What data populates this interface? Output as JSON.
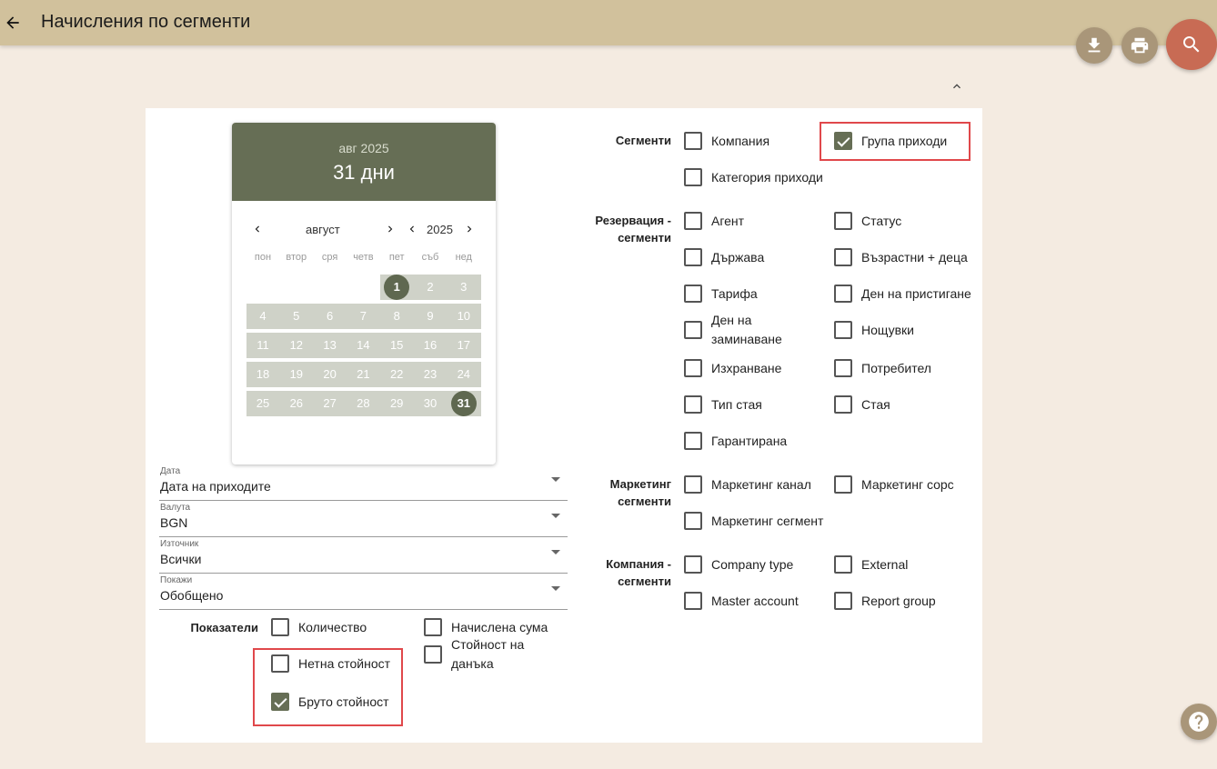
{
  "header": {
    "title": "Начисления по сегменти",
    "back_icon": "arrow-left-icon"
  },
  "actions": {
    "download_icon": "download-icon",
    "print_icon": "print-icon",
    "search_icon": "search-icon",
    "help_icon": "help-icon",
    "collapse_icon": "chevron-up-icon"
  },
  "colors": {
    "topbar": "#d1c19c",
    "accent": "#666e55",
    "search_fab": "#c86b54",
    "highlight": "#e0484b"
  },
  "calendar": {
    "header_month": "авг 2025",
    "header_days": "31 дни",
    "month_label": "август",
    "year_label": "2025",
    "weekdays": [
      "пон",
      "втор",
      "сря",
      "четв",
      "пет",
      "съб",
      "нед"
    ],
    "days": [
      "1",
      "2",
      "3",
      "4",
      "5",
      "6",
      "7",
      "8",
      "9",
      "10",
      "11",
      "12",
      "13",
      "14",
      "15",
      "16",
      "17",
      "18",
      "19",
      "20",
      "21",
      "22",
      "23",
      "24",
      "25",
      "26",
      "27",
      "28",
      "29",
      "30",
      "31"
    ],
    "range_start": "1",
    "range_end": "31"
  },
  "filters": [
    {
      "label": "Дата",
      "value": "Дата на приходите"
    },
    {
      "label": "Валута",
      "value": "BGN"
    },
    {
      "label": "Източник",
      "value": "Всички"
    },
    {
      "label": "Покажи",
      "value": "Обобщено"
    }
  ],
  "indicators": {
    "label": "Показатели",
    "items": [
      {
        "label": "Количество",
        "checked": false
      },
      {
        "label": "Начислена сума",
        "checked": false
      },
      {
        "label": "Нетна стойност",
        "checked": false
      },
      {
        "label": "Стойност на данъка",
        "checked": false
      },
      {
        "label": "Бруто стойност",
        "checked": true
      }
    ]
  },
  "segments": {
    "label": "Сегменти",
    "items": [
      {
        "label": "Компания",
        "checked": false
      },
      {
        "label": "Група приходи",
        "checked": true
      },
      {
        "label": "Категория приходи",
        "checked": false
      }
    ]
  },
  "reservation_segments": {
    "label": "Резервация - сегменти",
    "items": [
      {
        "label": "Агент",
        "checked": false
      },
      {
        "label": "Статус",
        "checked": false
      },
      {
        "label": "Държава",
        "checked": false
      },
      {
        "label": "Възрастни + деца",
        "checked": false
      },
      {
        "label": "Тарифа",
        "checked": false
      },
      {
        "label": "Ден на пристигане",
        "checked": false
      },
      {
        "label": "Ден на заминаване",
        "checked": false
      },
      {
        "label": "Нощувки",
        "checked": false
      },
      {
        "label": "Изхранване",
        "checked": false
      },
      {
        "label": "Потребител",
        "checked": false
      },
      {
        "label": "Тип стая",
        "checked": false
      },
      {
        "label": "Стая",
        "checked": false
      },
      {
        "label": "Гарантирана",
        "checked": false
      }
    ]
  },
  "marketing_segments": {
    "label": "Маркетинг сегменти",
    "items": [
      {
        "label": "Маркетинг канал",
        "checked": false
      },
      {
        "label": "Маркетинг сорс",
        "checked": false
      },
      {
        "label": "Маркетинг сегмент",
        "checked": false
      }
    ]
  },
  "company_segments": {
    "label": "Компания - сегменти",
    "items": [
      {
        "label": "Company type",
        "checked": false
      },
      {
        "label": "External",
        "checked": false
      },
      {
        "label": "Master account",
        "checked": false
      },
      {
        "label": "Report group",
        "checked": false
      }
    ]
  }
}
